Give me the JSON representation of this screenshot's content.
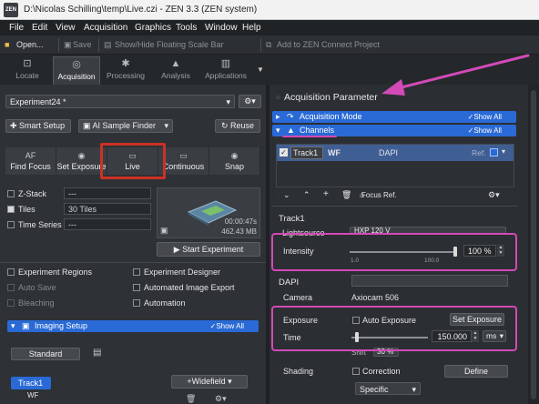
{
  "window": {
    "title": "D:\\Nicolas Schilling\\temp\\Live.czi - ZEN 3.3 (ZEN system)",
    "logo": "ZEN"
  },
  "menu": [
    "File",
    "Edit",
    "View",
    "Acquisition",
    "Graphics",
    "Tools",
    "Window",
    "Help"
  ],
  "toolbar": {
    "open": "Open...",
    "save": "Save",
    "scale_bar": "Show/Hide Floating Scale Bar",
    "connect": "Add to ZEN Connect Project"
  },
  "tabs": [
    {
      "label": "Locate",
      "icon": "locate-icon"
    },
    {
      "label": "Acquisition",
      "icon": "acquisition-icon"
    },
    {
      "label": "Processing",
      "icon": "processing-icon"
    },
    {
      "label": "Analysis",
      "icon": "analysis-icon"
    },
    {
      "label": "Applications",
      "icon": "applications-icon"
    }
  ],
  "left": {
    "experiment": "Experiment24 *",
    "smart_setup": "Smart Setup",
    "ai_finder": "AI Sample Finder",
    "reuse": "Reuse",
    "acq_buttons": [
      {
        "label": "Find Focus",
        "icon_text": "AF"
      },
      {
        "label": "Set Exposure",
        "icon_text": "◉"
      },
      {
        "label": "Live",
        "icon_text": "▭"
      },
      {
        "label": "Continuous",
        "icon_text": "▭"
      },
      {
        "label": "Snap",
        "icon_text": "◉"
      }
    ],
    "options": [
      {
        "label": "Z-Stack",
        "value": "---",
        "checked": false
      },
      {
        "label": "Tiles",
        "value": "30 Tiles",
        "checked": true
      },
      {
        "label": "Time Series",
        "value": "---",
        "checked": false
      }
    ],
    "time_remaining": "00:00:47s",
    "data_size": "462.43 MB",
    "start": "Start Experiment",
    "checks_left": [
      {
        "label": "Experiment Regions",
        "dim": false
      },
      {
        "label": "Auto Save",
        "dim": true
      },
      {
        "label": "Bleaching",
        "dim": true
      }
    ],
    "checks_right": [
      {
        "label": "Experiment Designer",
        "dim": false
      },
      {
        "label": "Automated Image Export",
        "dim": false
      },
      {
        "label": "Automation",
        "dim": false
      }
    ],
    "imaging_setup": "Imaging Setup",
    "show_all": "Show All",
    "standard": "Standard",
    "track": "Track1",
    "track_sub": "WF",
    "widefield": "+Widefield"
  },
  "right": {
    "panel_title": "Acquisition Parameter",
    "acq_mode": "Acquisition Mode",
    "channels": "Channels",
    "show_all": "Show All",
    "track": "Track1",
    "track_type": "WF",
    "channel": "DAPI",
    "ref": "Ref.",
    "focus_ref": "Focus Ref.",
    "track_title": "Track1",
    "lightsource_label": "Lightsource",
    "lightsource": "HXP 120 V",
    "intensity_label": "Intensity",
    "intensity": "100 %",
    "intensity_percent": 100,
    "tick_min": "1.0",
    "tick_max": "100.0",
    "dapi": "DAPI",
    "camera_label": "Camera",
    "camera": "Axiocam 506",
    "exposure_label": "Exposure",
    "auto_exposure": "Auto Exposure",
    "set_exposure": "Set Exposure",
    "time_label": "Time",
    "time_value": "150.000",
    "time_unit": "ms",
    "shift_label": "Shift",
    "shift_value": "30 %",
    "shading_label": "Shading",
    "correction": "Correction",
    "define": "Define",
    "specific": "Specific"
  },
  "colors": {
    "accent": "#2a6ad6",
    "annotation": "#d24ab8",
    "live_highlight": "#cc3125"
  }
}
